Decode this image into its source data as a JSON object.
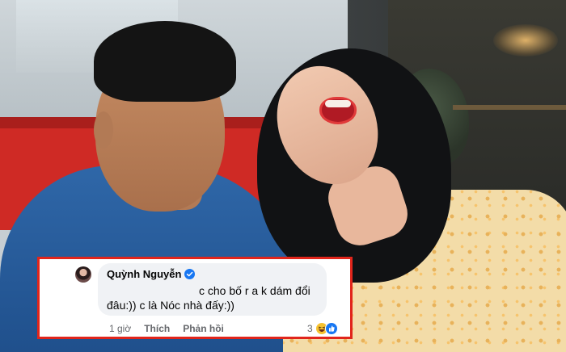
{
  "comment": {
    "author_name": "Quỳnh Nguyễn",
    "text": "c cho bố r a k dám đổi đâu:)) c là Nóc nhà đấy:))",
    "time": "1 giờ",
    "like_label": "Thích",
    "reply_label": "Phản hồi",
    "reaction_count": "3",
    "reaction_icons": [
      "haha-icon",
      "like-icon"
    ]
  },
  "colors": {
    "highlight_border": "#e1251b",
    "bubble_bg": "#f0f2f5",
    "verified_blue": "#1877f2",
    "meta_text": "#65676b"
  }
}
